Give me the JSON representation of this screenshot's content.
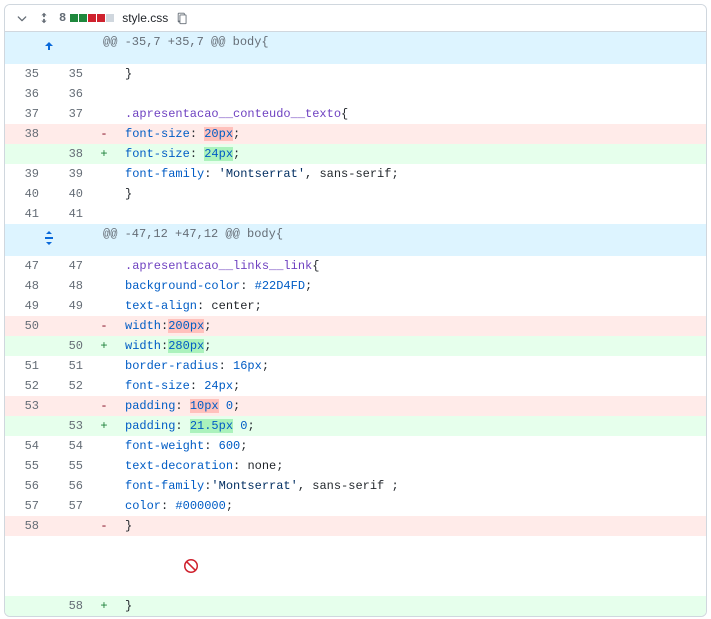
{
  "file": {
    "name": "style.css",
    "changes": "8"
  },
  "icons": {
    "caret": "chevron-down-icon",
    "expandAll": "expand-all-icon",
    "copy": "copy-icon",
    "expandUp": "expand-up-icon",
    "expandBoth": "expand-both-icon",
    "noNewline": "no-newline-icon"
  },
  "hunk1": {
    "header": "@@ -35,7 +35,7 @@ body{"
  },
  "hunk2": {
    "header": "@@ -47,12 +47,12 @@ body{"
  },
  "ln": {
    "r35": "35",
    "r36": "36",
    "r37": "37",
    "r38": "38",
    "r39": "39",
    "r40": "40",
    "r41": "41",
    "r47": "47",
    "r48": "48",
    "r49": "49",
    "r50": "50",
    "r51": "51",
    "r52": "52",
    "r53": "53",
    "r54": "54",
    "r55": "55",
    "r56": "56",
    "r57": "57",
    "r58": "58"
  },
  "marker": {
    "minus": "-",
    "plus": "+"
  },
  "l35": {
    "brace": "}"
  },
  "l37": {
    "sel": ".apresentacao__conteudo__texto",
    "brace": "{"
  },
  "fontSize": {
    "prop": "font-size",
    "colon": ": ",
    "del": "20px",
    "add": "24px",
    "semi": ";"
  },
  "l39": {
    "prop": "font-family",
    "colon": ": ",
    "str": "'Montserrat'",
    "rest": ", sans-serif;"
  },
  "l40": {
    "brace": "}"
  },
  "l47": {
    "sel": ".apresentacao__links__link",
    "brace": "{"
  },
  "l48": {
    "prop": "background-color",
    "colon": ": ",
    "val": "#22D4FD",
    "semi": ";"
  },
  "l49": {
    "prop": "text-align",
    "colon": ": ",
    "val": "center",
    "semi": ";"
  },
  "width": {
    "prop": "width",
    "colon": ":",
    "del": "200px",
    "add": "280px",
    "semi": ";"
  },
  "l51": {
    "prop": "border-radius",
    "colon": ": ",
    "val": "16px",
    "semi": ";"
  },
  "l52": {
    "prop": "font-size",
    "colon": ": ",
    "val": "24px",
    "semi": ";"
  },
  "padding": {
    "prop": "padding",
    "colon": ": ",
    "del": "10px",
    "add": "21.5px",
    "zero": " 0",
    "semi": ";"
  },
  "l54": {
    "prop": "font-weight",
    "colon": ": ",
    "val": "600",
    "semi": ";"
  },
  "l55": {
    "prop": "text-decoration",
    "colon": ": ",
    "val": "none",
    "semi": ";"
  },
  "l56": {
    "prop": "font-family",
    "colon": ":",
    "str": "'Montserrat'",
    "rest": ", sans-serif ;"
  },
  "l57": {
    "prop": "color",
    "colon": ": ",
    "val": "#000000",
    "semi": ";"
  },
  "l58": {
    "brace": "}"
  }
}
